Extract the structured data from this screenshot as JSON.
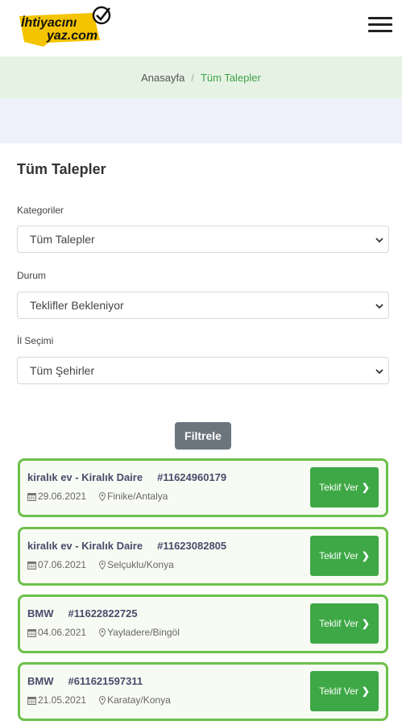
{
  "header": {
    "logo_line1": "İhtiyacını",
    "logo_line2": "yaz.com"
  },
  "breadcrumb": {
    "home": "Anasayfa",
    "separator": "/",
    "current": "Tüm Talepler"
  },
  "page_title": "Tüm Talepler",
  "filters": {
    "category_label": "Kategoriler",
    "category_value": "Tüm Talepler",
    "status_label": "Durum",
    "status_value": "Teklifler Bekleniyor",
    "city_label": "İl Seçimi",
    "city_value": "Tüm Şehirler",
    "filter_button": "Filtrele"
  },
  "requests": [
    {
      "title": "kiralık ev - Kiralık Daire",
      "number": "#11624960179",
      "date": "29.06.2021",
      "location": "Finike/Antalya",
      "button": "Teklif Ver"
    },
    {
      "title": "kiralık ev - Kiralık Daire",
      "number": "#11623082805",
      "date": "07.06.2021",
      "location": "Selçuklu/Konya",
      "button": "Teklif Ver"
    },
    {
      "title": "BMW",
      "number": "#11622822725",
      "date": "04.06.2021",
      "location": "Yayladere/Bingöl",
      "button": "Teklif Ver"
    },
    {
      "title": "BMW",
      "number": "#611621597311",
      "date": "21.05.2021",
      "location": "Karatay/Konya",
      "button": "Teklif Ver"
    }
  ],
  "colors": {
    "accent_green": "#3da845",
    "card_border": "#6cc04a",
    "logo_yellow": "#f5c400"
  }
}
